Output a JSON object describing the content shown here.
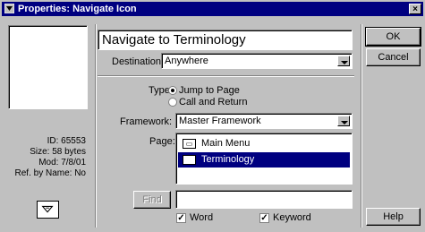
{
  "window": {
    "title": "Properties: Navigate Icon",
    "close_label": "×"
  },
  "info": {
    "id": "ID: 65553",
    "size": "Size: 58 bytes",
    "mod": "Mod: 7/8/01",
    "ref": "Ref. by Name: No"
  },
  "name_field": {
    "value": "Navigate to Terminology"
  },
  "destination": {
    "label": "Destination:",
    "value": "Anywhere"
  },
  "type": {
    "label": "Type:",
    "options": [
      "Jump to Page",
      "Call and Return"
    ],
    "selected": "Jump to Page"
  },
  "framework": {
    "label": "Framework:",
    "value": "Master Framework"
  },
  "page": {
    "label": "Page:",
    "items": [
      {
        "label": "Main Menu",
        "selected": false
      },
      {
        "label": "Terminology",
        "selected": true
      }
    ]
  },
  "find": {
    "button_label": "Find",
    "value": ""
  },
  "options": {
    "word": {
      "label": "Word",
      "checked": true
    },
    "keyword": {
      "label": "Keyword",
      "checked": true
    }
  },
  "buttons": {
    "ok": "OK",
    "cancel": "Cancel",
    "help": "Help"
  }
}
